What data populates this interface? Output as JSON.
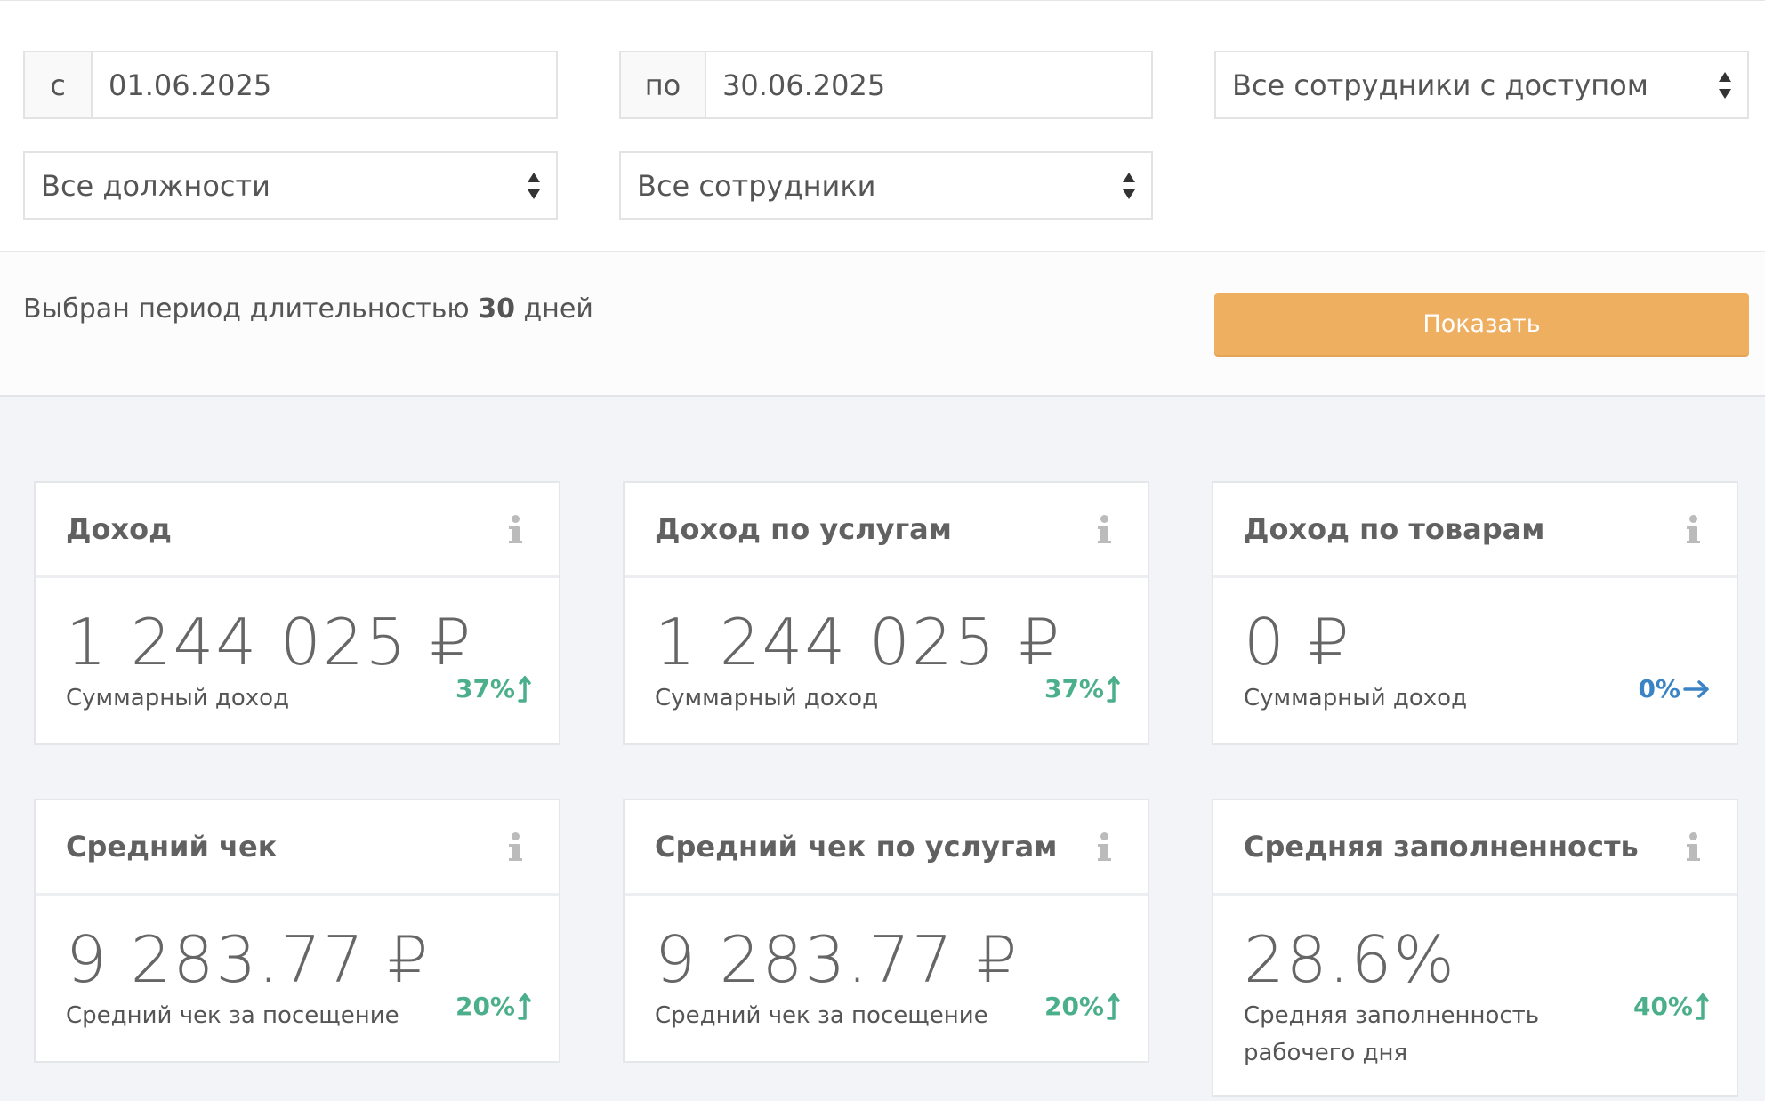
{
  "filters": {
    "from_label": "с",
    "from_value": "01.06.2025",
    "to_label": "по",
    "to_value": "30.06.2025",
    "employees_access": "Все сотрудники с доступом",
    "positions": "Все должности",
    "employees": "Все сотрудники"
  },
  "period": {
    "prefix": "Выбран период длительностью",
    "days": "30",
    "suffix": "дней",
    "show_button": "Показать"
  },
  "cards": [
    {
      "title": "Доход",
      "value": "1 244 025 ₽",
      "subtitle": "Суммарный доход",
      "trend": "37%",
      "trend_dir": "up"
    },
    {
      "title": "Доход по услугам",
      "value": "1 244 025 ₽",
      "subtitle": "Суммарный доход",
      "trend": "37%",
      "trend_dir": "up"
    },
    {
      "title": "Доход по товарам",
      "value": "0 ₽",
      "subtitle": "Суммарный доход",
      "trend": "0%",
      "trend_dir": "flat"
    },
    {
      "title": "Средний чек",
      "value": "9 283.77 ₽",
      "subtitle": "Средний чек за посещение",
      "trend": "20%",
      "trend_dir": "up"
    },
    {
      "title": "Средний чек по услугам",
      "value": "9 283.77 ₽",
      "subtitle": "Средний чек за посещение",
      "trend": "20%",
      "trend_dir": "up"
    },
    {
      "title": "Средняя заполненность",
      "value": "28.6%",
      "subtitle": "Средняя заполненность рабочего дня",
      "trend": "40%",
      "trend_dir": "up"
    }
  ],
  "colors": {
    "accent_button": "#eeaf61",
    "trend_up": "#4caf8c",
    "trend_flat": "#3a83c4"
  }
}
